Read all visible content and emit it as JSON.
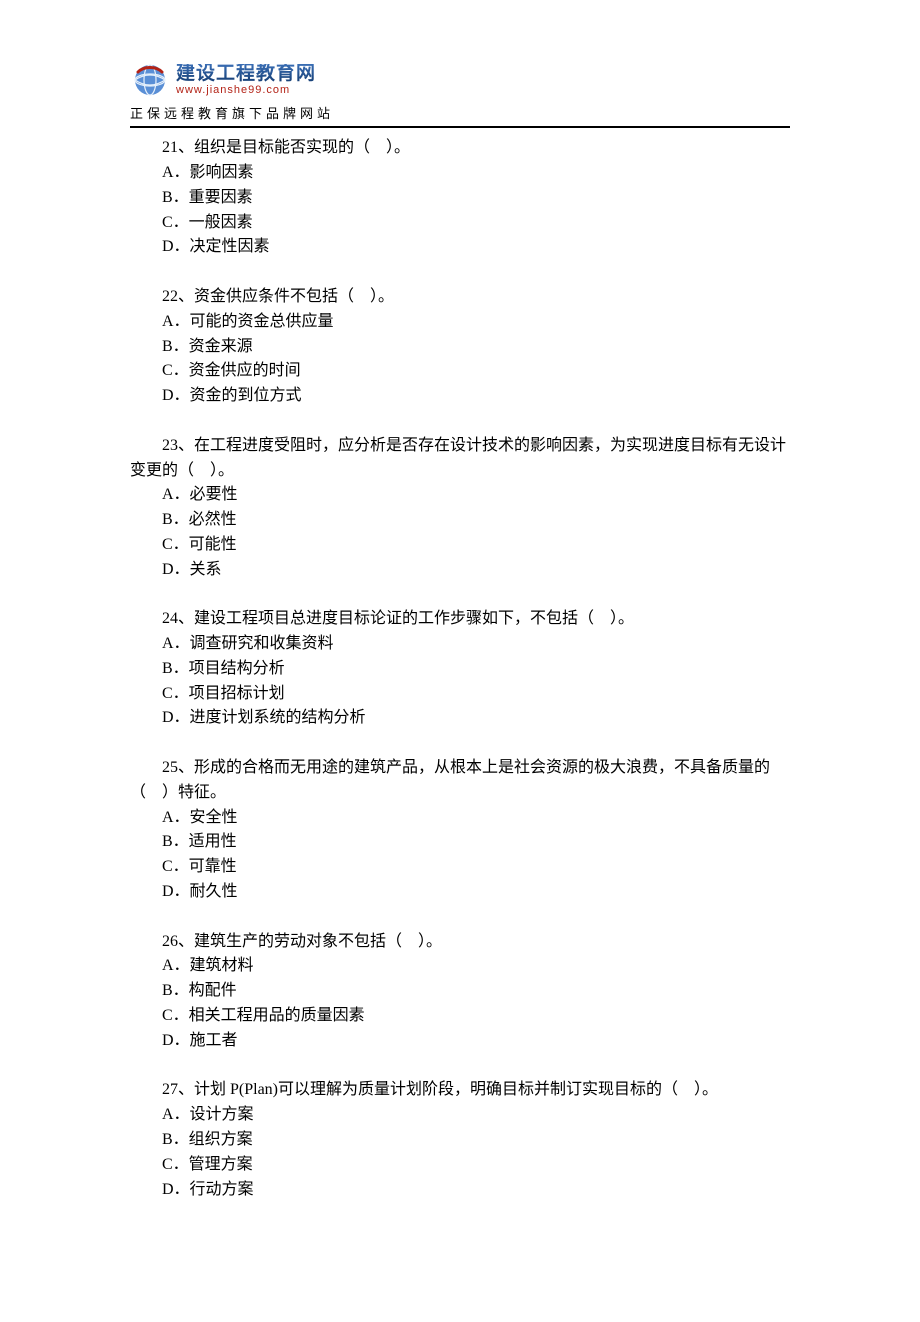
{
  "header": {
    "brand": "建设工程教育网",
    "url": "www.jianshe99.com",
    "tagline": "正保远程教育旗下品牌网站"
  },
  "questions": [
    {
      "stem": "21、组织是目标能否实现的（　）。",
      "options": [
        "A．影响因素",
        "B．重要因素",
        "C．一般因素",
        "D．决定性因素"
      ]
    },
    {
      "stem": "22、资金供应条件不包括（　）。",
      "options": [
        "A．可能的资金总供应量",
        "B．资金来源",
        "C．资金供应的时间",
        "D．资金的到位方式"
      ]
    },
    {
      "stem": "23、在工程进度受阻时，应分析是否存在设计技术的影响因素，为实现进度目标有无设计变更的（　）。",
      "options": [
        "A．必要性",
        "B．必然性",
        "C．可能性",
        "D．关系"
      ]
    },
    {
      "stem": "24、建设工程项目总进度目标论证的工作步骤如下，不包括（　）。",
      "options": [
        "A．调查研究和收集资料",
        "B．项目结构分析",
        "C．项目招标计划",
        "D．进度计划系统的结构分析"
      ]
    },
    {
      "stem": "25、形成的合格而无用途的建筑产品，从根本上是社会资源的极大浪费，不具备质量的（　）特征。",
      "options": [
        "A．安全性",
        "B．适用性",
        "C．可靠性",
        "D．耐久性"
      ]
    },
    {
      "stem": "26、建筑生产的劳动对象不包括（　）。",
      "options": [
        "A．建筑材料",
        "B．构配件",
        "C．相关工程用品的质量因素",
        "D．施工者"
      ]
    },
    {
      "stem": "27、计划 P(Plan)可以理解为质量计划阶段，明确目标并制订实现目标的（　）。",
      "options": [
        "A．设计方案",
        "B．组织方案",
        "C．管理方案",
        "D．行动方案"
      ]
    }
  ]
}
